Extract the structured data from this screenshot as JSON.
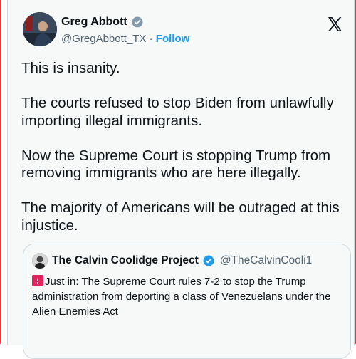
{
  "author": {
    "name": "Greg Abbott",
    "handle": "@GregAbbott_TX",
    "separator": "·",
    "follow_label": "Follow"
  },
  "tweet": {
    "paragraphs": [
      "This is insanity.",
      "The courts refused to stop Biden from unlawfully importing illegal immigrants.",
      "Now the Supreme Court is stopping Trump from removing immigrants who are here illegally.",
      "The majority of Americans will be outraged at this injustice."
    ]
  },
  "quoted": {
    "name": "The Calvin Coolidge Project",
    "handle": "@TheCalvinCooli1",
    "text": "Just in: The Supreme Court rules 7-2 to stop the Trump administration from deporting a class of Venezuelans under the Alien Enemies Act"
  },
  "colors": {
    "accent": "#1d9bf0",
    "secondary_text": "#536471",
    "card_background": "#f7f9f9"
  }
}
